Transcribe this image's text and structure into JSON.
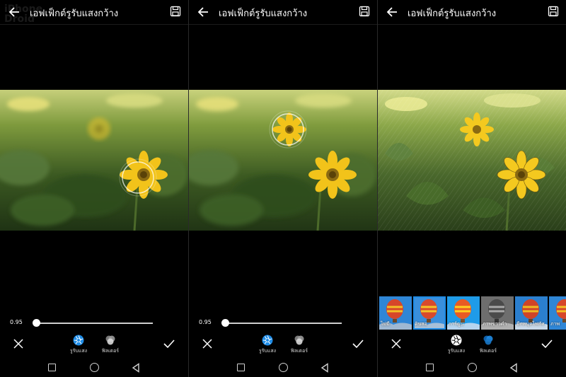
{
  "screen_title": "เอฟเฟ็กต์รูรับแสงกว้าง",
  "watermark_line1": "iPhone",
  "watermark_line2": "Droid",
  "slider_value": "0.95",
  "slider_level": 0.0,
  "tools": {
    "aperture_label": "รูรับแสง",
    "filter_label": "ฟิลเตอร์"
  },
  "filters": [
    {
      "label": "ไม่มี"
    },
    {
      "label": "ดินสอ"
    },
    {
      "label": "การ์ตูน"
    },
    {
      "label": "ภาพขาวดำ"
    },
    {
      "label": "บีกหนุดไฟกัส"
    },
    {
      "label": "ภาพ"
    }
  ],
  "colors": {
    "accent": "#1f8ce6",
    "background": "#000000",
    "flower": "#f2c31a"
  }
}
